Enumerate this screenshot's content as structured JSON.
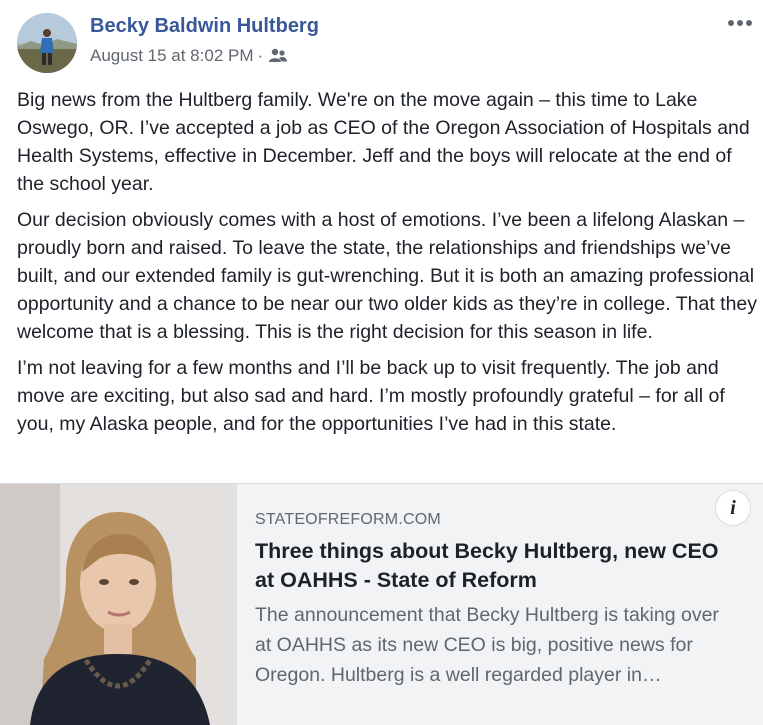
{
  "post": {
    "author": "Becky Baldwin Hultberg",
    "timestamp": "August 15 at 8:02 PM",
    "separator": "·",
    "audience_icon": "friends-icon",
    "more_icon": "more-options-icon",
    "paragraphs": [
      "Big news from the Hultberg family. We're on the move again – this time to Lake Oswego, OR. I’ve accepted a job as CEO of the Oregon Association of Hospitals and Health Systems, effective in December. Jeff and the boys will relocate at the end of the school year.",
      "Our decision obviously comes with a host of emotions. I’ve been a lifelong Alaskan – proudly born and raised. To leave the state, the relationships and friendships we’ve built, and our extended family is gut-wrenching. But it is both an amazing professional opportunity and a chance to be near our two older kids as they’re in college. That they welcome that is a blessing. This is the right decision for this season in life.",
      "I’m not leaving for a few months and I’ll be back up to visit frequently. The job and move are exciting, but also sad and hard. I’m mostly profoundly grateful – for all of you, my Alaska people, and for the opportunities I’ve had in this state."
    ]
  },
  "link_preview": {
    "domain": "STATEOFREFORM.COM",
    "title": "Three things about Becky Hultberg, new CEO at OAHHS - State of Reform",
    "description": "The announcement that Becky Hultberg is taking over at OAHHS as its new CEO is big, positive news for Oregon. Hultberg is a well regarded player in…",
    "info_label": "i"
  },
  "colors": {
    "author_link": "#385898",
    "secondary_text": "#606770",
    "body_text": "#1d2129",
    "card_background": "#f2f3f5"
  }
}
